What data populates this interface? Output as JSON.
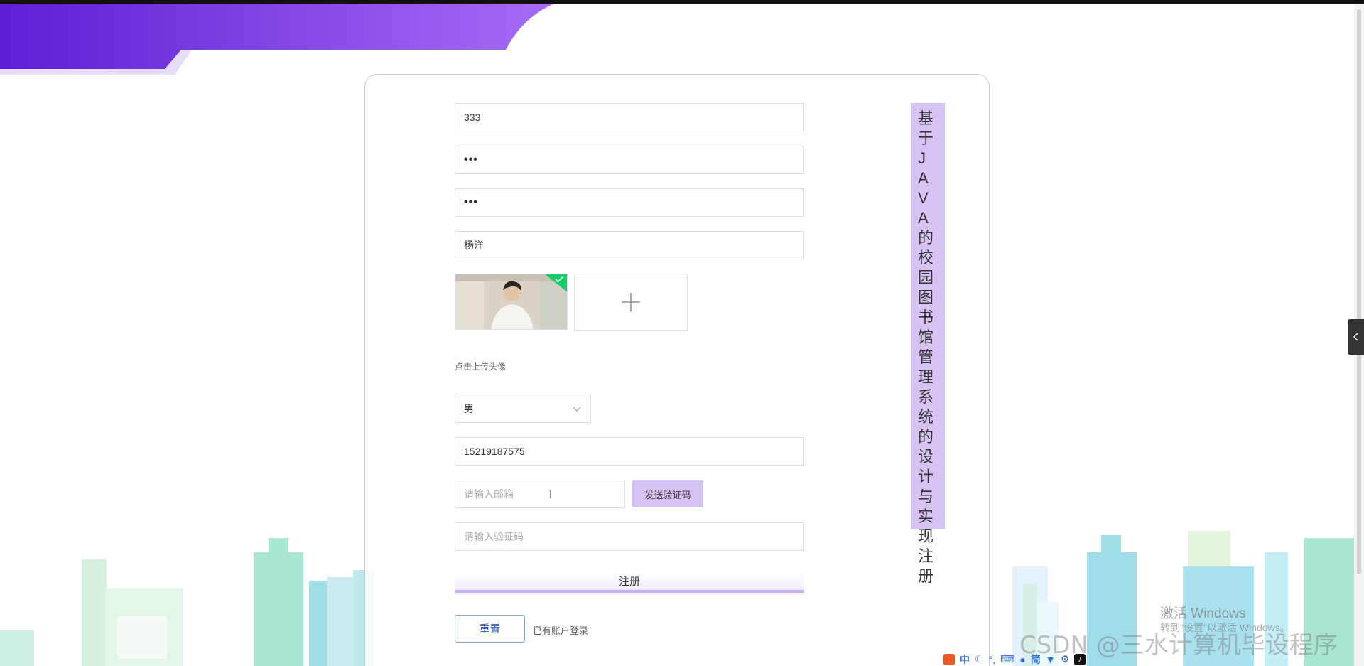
{
  "form": {
    "username": "333",
    "password_mask": "•••",
    "confirm_password_mask": "•••",
    "name": "杨洋",
    "upload_hint": "点击上传头像",
    "gender": "男",
    "phone": "15219187575",
    "email_placeholder": "请输入邮箱",
    "send_code_label": "发送验证码",
    "code_placeholder": "请输入验证码",
    "register_label": "注册",
    "reset_label": "重置",
    "login_link": "已有账户登录"
  },
  "title": "基于JAVA的校园图书馆管理系统的设计与实现注册",
  "overlay": {
    "watermark": "CSDN @三水计算机毕设程序",
    "windows_activate_line1": "激活 Windows",
    "windows_activate_line2": "转到\"设置\"以激活 Windows。"
  },
  "ime_tray": {
    "items": [
      "中",
      "简"
    ]
  },
  "colors": {
    "accent_purple": "#8b5cf6",
    "title_bg": "#d4c3f3",
    "send_btn_bg": "#d4c3f3"
  },
  "icons": [
    "plus-icon",
    "chevron-down-icon",
    "chevron-left-icon",
    "check-icon"
  ]
}
